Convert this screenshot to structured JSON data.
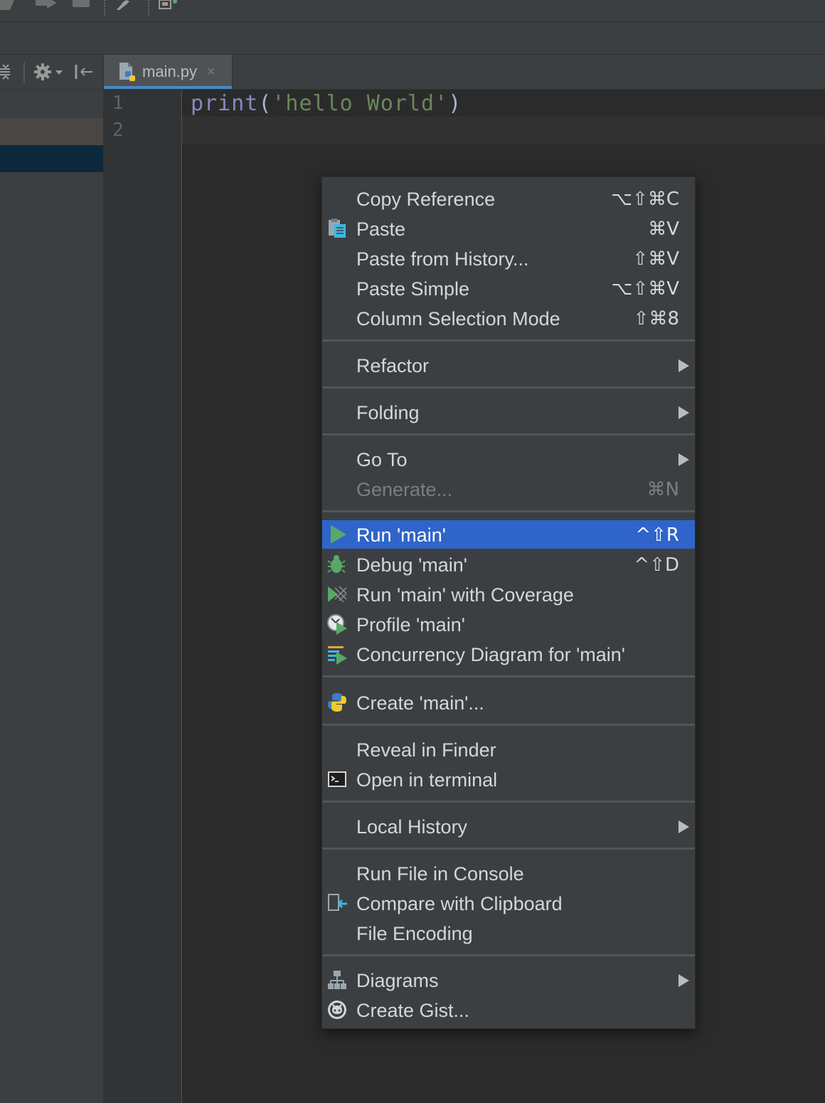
{
  "toolbar": {
    "icons": [
      "back-icon",
      "forward-icon",
      "stop-icon",
      "wrench-icon",
      "sdk-icon"
    ]
  },
  "left_panel": {
    "header_icons": [
      "collapse-icon",
      "gear-icon",
      "hide-panel-icon"
    ]
  },
  "tab": {
    "label": "main.py",
    "close": "×",
    "icon": "python-file-icon"
  },
  "editor": {
    "line_numbers": [
      "1",
      "2"
    ],
    "code": {
      "fn": "print",
      "open": "(",
      "str": "'hello World'",
      "close": ")"
    }
  },
  "context_menu": {
    "items": [
      {
        "label": "Copy Reference",
        "shortcut": "⌥⇧⌘C"
      },
      {
        "label": "Paste",
        "shortcut": "⌘V",
        "icon": "paste-icon"
      },
      {
        "label": "Paste from History...",
        "shortcut": "⇧⌘V"
      },
      {
        "label": "Paste Simple",
        "shortcut": "⌥⇧⌘V"
      },
      {
        "label": "Column Selection Mode",
        "shortcut": "⇧⌘8"
      },
      {
        "label": "Refactor",
        "submenu": true
      },
      {
        "label": "Folding",
        "submenu": true
      },
      {
        "label": "Go To",
        "submenu": true
      },
      {
        "label": "Generate...",
        "shortcut": "⌘N",
        "disabled": true
      },
      {
        "label": "Run 'main'",
        "shortcut": "^⇧R",
        "icon": "run-icon",
        "selected": true
      },
      {
        "label": "Debug 'main'",
        "shortcut": "^⇧D",
        "icon": "debug-icon"
      },
      {
        "label": "Run 'main' with Coverage",
        "icon": "coverage-icon"
      },
      {
        "label": "Profile 'main'",
        "icon": "profile-icon"
      },
      {
        "label": "Concurrency Diagram for 'main'",
        "icon": "concurrency-icon"
      },
      {
        "label": "Create 'main'...",
        "icon": "python-icon"
      },
      {
        "label": "Reveal in Finder"
      },
      {
        "label": "Open in terminal",
        "icon": "terminal-icon"
      },
      {
        "label": "Local History",
        "submenu": true
      },
      {
        "label": "Run File in Console"
      },
      {
        "label": "Compare with Clipboard",
        "icon": "compare-icon"
      },
      {
        "label": "File Encoding"
      },
      {
        "label": "Diagrams",
        "submenu": true,
        "icon": "diagram-icon"
      },
      {
        "label": "Create Gist...",
        "icon": "github-icon"
      }
    ]
  }
}
